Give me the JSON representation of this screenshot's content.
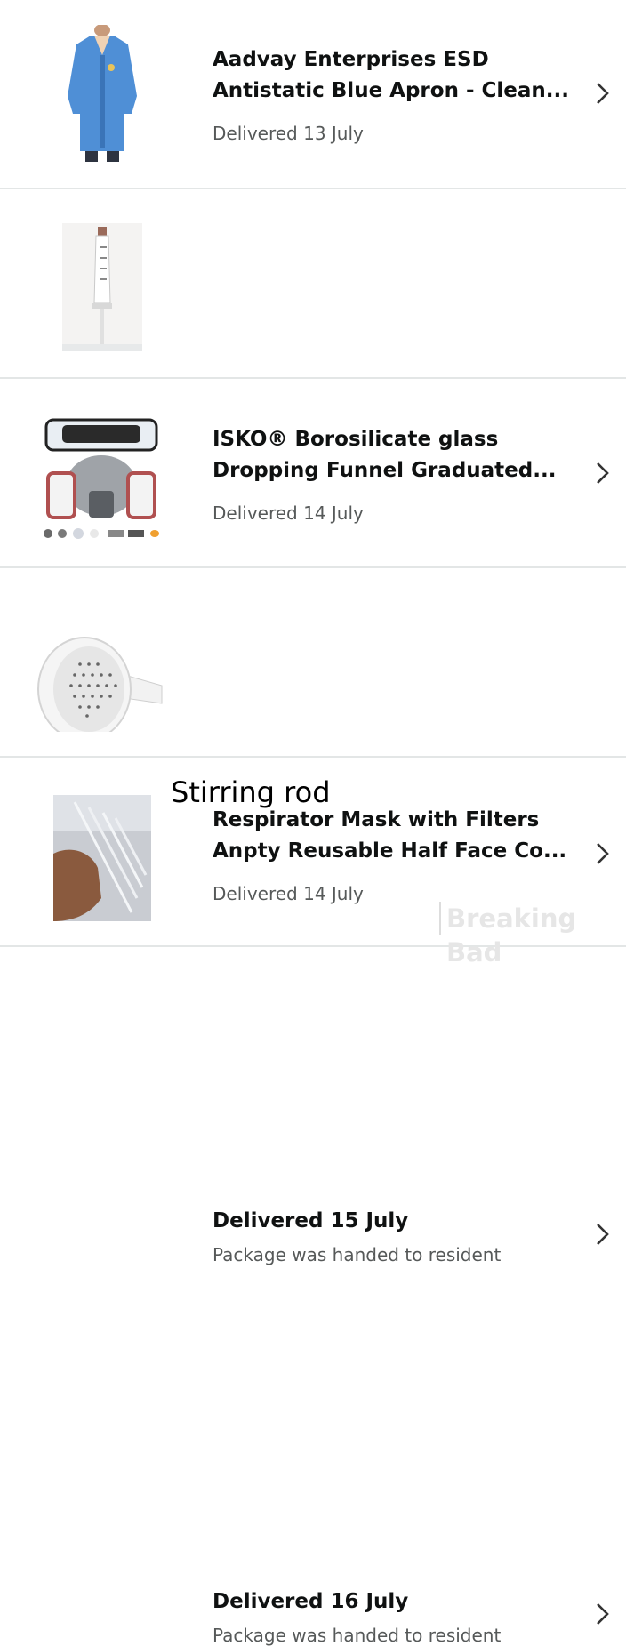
{
  "orders": [
    {
      "title_line1": "Aadvay Enterprises ESD",
      "title_line2": "Antistatic Blue Apron - Clean...",
      "status": "Delivered 13 July",
      "image_icon": "blue-lab-coat"
    },
    {
      "title_line1": "ISKO® Borosilicate glass",
      "title_line2": "Dropping Funnel Graduated...",
      "status": "Delivered 14 July",
      "image_icon": "dropping-funnel"
    },
    {
      "title_line1": "Respirator Mask with Filters",
      "title_line2": "Anpty Reusable Half Face Co...",
      "status": "Delivered 14 July",
      "image_icon": "respirator-mask"
    },
    {
      "heading": "Delivered 15 July",
      "note": "Package was handed to resident",
      "image_icon": "buchner-funnel"
    },
    {
      "heading": "Delivered 16 July",
      "note": "Package was handed to resident",
      "image_icon": "stirring-rod"
    }
  ],
  "overlay_caption": "Stirring rod",
  "watermark": "Breaking Bad",
  "colors": {
    "title": "#0f1111",
    "secondary": "#565959",
    "divider": "#e3e6e6"
  }
}
